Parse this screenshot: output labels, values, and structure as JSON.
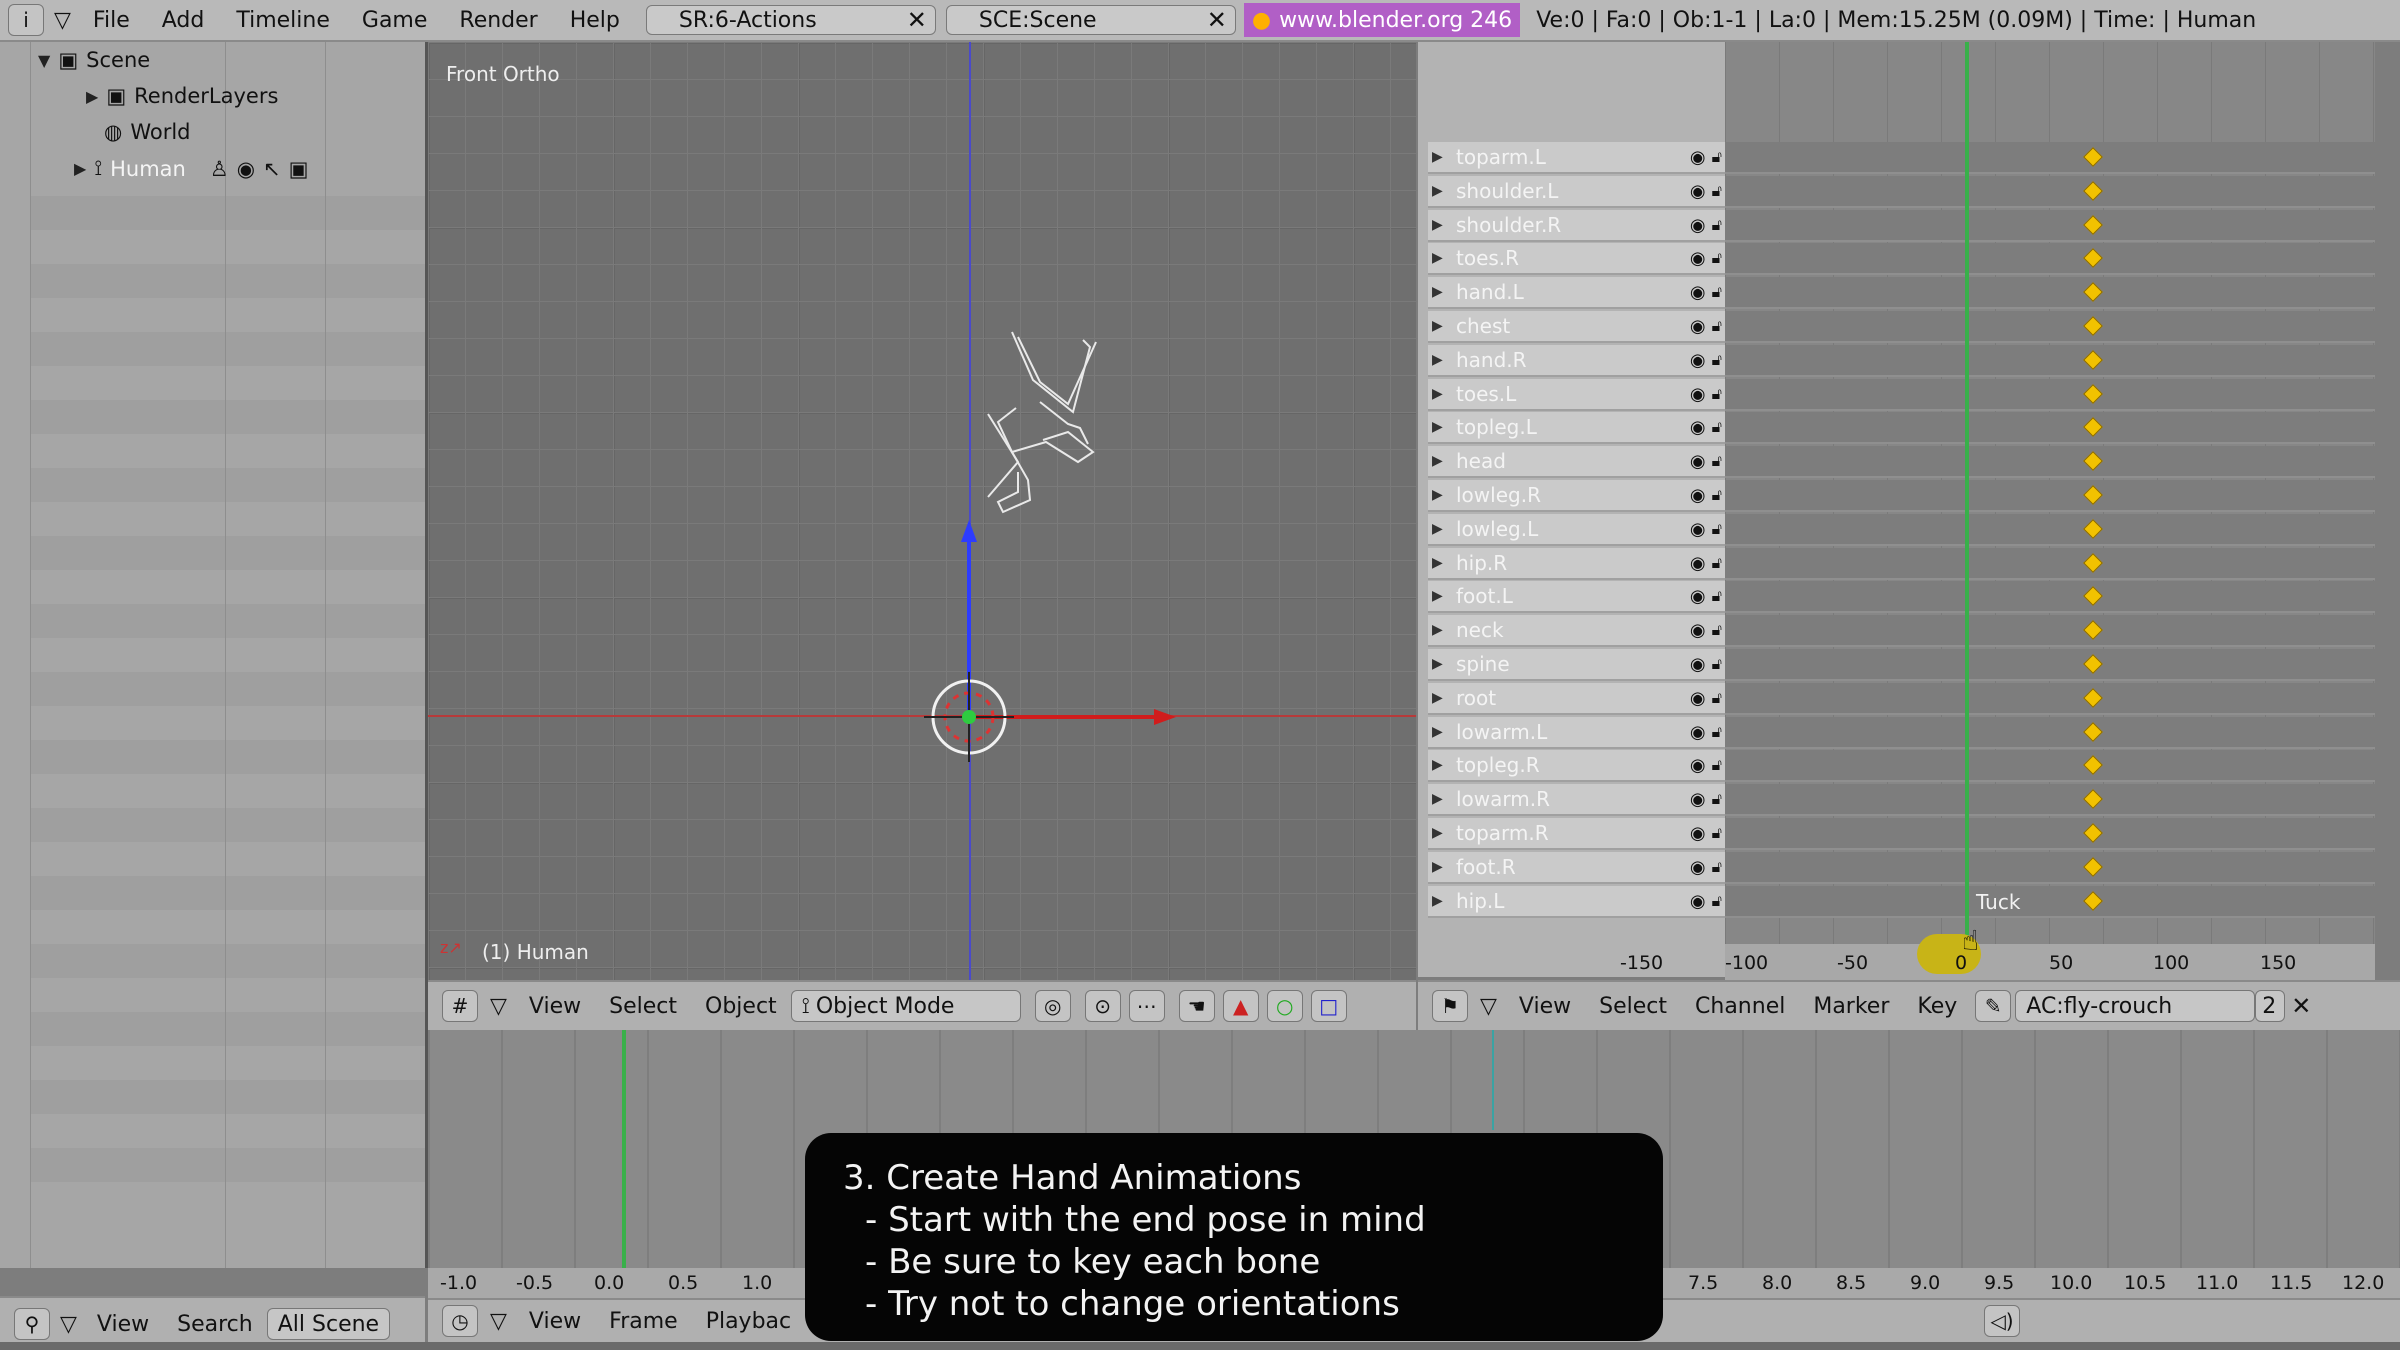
{
  "topbar": {
    "menus": [
      "File",
      "Add",
      "Timeline",
      "Game",
      "Render",
      "Help"
    ],
    "screen_field": "SR:6-Actions",
    "scene_field": "SCE:Scene",
    "url": "www.blender.org 246",
    "stats": "Ve:0 | Fa:0 | Ob:1-1 | La:0  | Mem:15.25M (0.09M)  | Time: | Human"
  },
  "outliner": {
    "items": [
      {
        "label": "Scene"
      },
      {
        "label": "RenderLayers"
      },
      {
        "label": "World"
      },
      {
        "label": "Human"
      }
    ],
    "header": {
      "view": "View",
      "search": "Search",
      "scope": "All Scene"
    }
  },
  "viewport": {
    "label": "Front Ortho",
    "object_label": "(1) Human",
    "header": {
      "view": "View",
      "select": "Select",
      "object": "Object",
      "mode": "Object Mode"
    }
  },
  "action_editor": {
    "channels": [
      "toparm.L",
      "shoulder.L",
      "shoulder.R",
      "toes.R",
      "hand.L",
      "chest",
      "hand.R",
      "toes.L",
      "topleg.L",
      "head",
      "lowleg.R",
      "lowleg.L",
      "hip.R",
      "foot.L",
      "neck",
      "spine",
      "root",
      "lowarm.L",
      "topleg.R",
      "lowarm.R",
      "toparm.R",
      "foot.R",
      "hip.L"
    ],
    "marker_label": "Tuck",
    "ruler": [
      "-150",
      "-100",
      "-50",
      "0",
      "50",
      "100",
      "150"
    ],
    "header": {
      "view": "View",
      "select": "Select",
      "channel": "Channel",
      "marker": "Marker",
      "key": "Key",
      "action": "AC:fly-crouch",
      "users": "2"
    }
  },
  "timeline": {
    "ticks": [
      "-1.0",
      "-0.5",
      "0.0",
      "0.5",
      "1.0",
      "7.5",
      "8.0",
      "8.5",
      "9.0",
      "9.5",
      "10.0",
      "10.5",
      "11.0",
      "11.5",
      "12.0"
    ],
    "header": {
      "view": "View",
      "frame": "Frame",
      "playback": "Playbac"
    }
  },
  "caption": {
    "title": "3. Create Hand Animations",
    "lines": [
      "- Start with the end pose in mind",
      "- Be sure to key each bone",
      "- Try not to change orientations"
    ]
  },
  "colors": {
    "accent_url": "#b15fc6",
    "keyframe": "#f2c200",
    "current_frame": "#39b04a"
  }
}
